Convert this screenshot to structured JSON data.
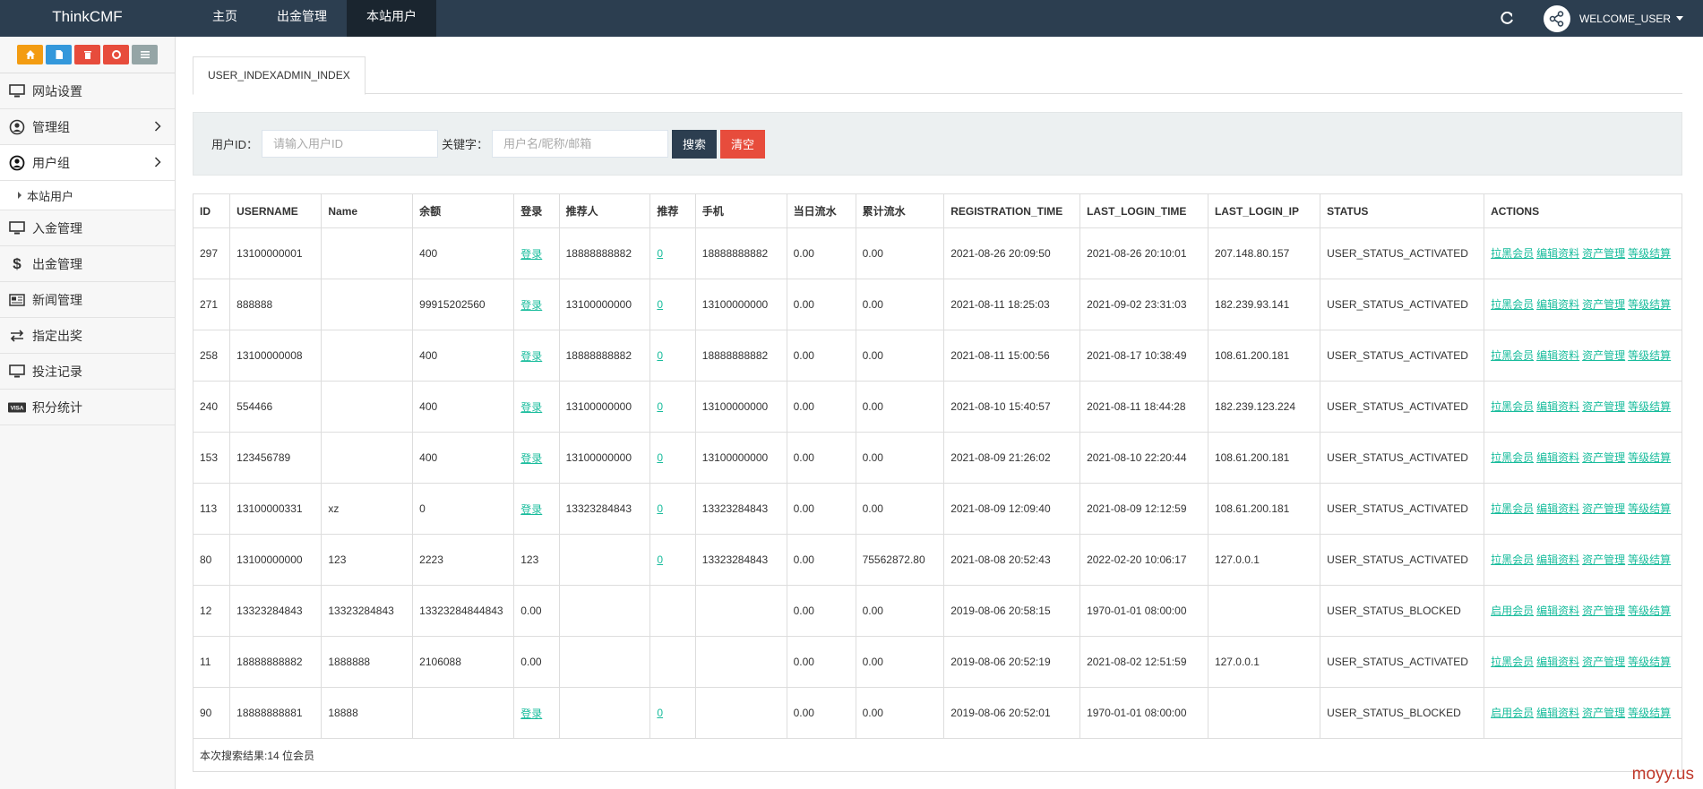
{
  "brand": "ThinkCMF",
  "nav": {
    "tabs": [
      "主页",
      "出金管理",
      "本站用户"
    ],
    "active": 2
  },
  "header": {
    "welcome": "WELCOME_USER"
  },
  "sidebar": {
    "items": [
      {
        "label": "网站设置",
        "icon": "monitor-icon"
      },
      {
        "label": "管理组",
        "icon": "user-circle-icon",
        "chevron": true
      },
      {
        "label": "用户组",
        "icon": "user-circle-icon",
        "chevron": true,
        "active": true
      },
      {
        "label": "入金管理",
        "icon": "monitor-icon"
      },
      {
        "label": "出金管理",
        "icon": "dollar-icon"
      },
      {
        "label": "新闻管理",
        "icon": "newspaper-icon"
      },
      {
        "label": "指定出奖",
        "icon": "exchange-icon"
      },
      {
        "label": "投注记录",
        "icon": "monitor-icon"
      },
      {
        "label": "积分统计",
        "icon": "visa-icon"
      }
    ],
    "sub_item": "本站用户"
  },
  "page_tab": "USER_INDEXADMIN_INDEX",
  "search": {
    "uid_label": "用户ID：",
    "uid_placeholder": "请输入用户ID",
    "keyword_label": "关键字：",
    "keyword_placeholder": "用户名/昵称/邮箱",
    "search_button": "搜索",
    "clear_button": "清空"
  },
  "table": {
    "headers": [
      "ID",
      "USERNAME",
      "Name",
      "余额",
      "登录",
      "推荐人",
      "推荐",
      "手机",
      "当日流水",
      "累计流水",
      "REGISTRATION_TIME",
      "LAST_LOGIN_TIME",
      "LAST_LOGIN_IP",
      "STATUS",
      "ACTIONS"
    ],
    "rows": [
      {
        "id": "297",
        "username": "13100000001",
        "name": "",
        "balance": "400",
        "login": "登录",
        "referrer": "18888888882",
        "refcount": "0",
        "phone": "18888888882",
        "daily": "0.00",
        "total": "0.00",
        "reg": "2021-08-26 20:09:50",
        "last": "2021-08-26 20:10:01",
        "ip": "207.148.80.157",
        "status": "USER_STATUS_ACTIVATED",
        "actions": [
          "拉黑会员",
          "编辑资料",
          "资产管理",
          "等级结算"
        ]
      },
      {
        "id": "271",
        "username": "888888",
        "name": "",
        "balance": "99915202560",
        "login": "登录",
        "referrer": "13100000000",
        "refcount": "0",
        "phone": "13100000000",
        "daily": "0.00",
        "total": "0.00",
        "reg": "2021-08-11 18:25:03",
        "last": "2021-09-02 23:31:03",
        "ip": "182.239.93.141",
        "status": "USER_STATUS_ACTIVATED",
        "actions": [
          "拉黑会员",
          "编辑资料",
          "资产管理",
          "等级结算"
        ]
      },
      {
        "id": "258",
        "username": "13100000008",
        "name": "",
        "balance": "400",
        "login": "登录",
        "referrer": "18888888882",
        "refcount": "0",
        "phone": "18888888882",
        "daily": "0.00",
        "total": "0.00",
        "reg": "2021-08-11 15:00:56",
        "last": "2021-08-17 10:38:49",
        "ip": "108.61.200.181",
        "status": "USER_STATUS_ACTIVATED",
        "actions": [
          "拉黑会员",
          "编辑资料",
          "资产管理",
          "等级结算"
        ]
      },
      {
        "id": "240",
        "username": "554466",
        "name": "",
        "balance": "400",
        "login": "登录",
        "referrer": "13100000000",
        "refcount": "0",
        "phone": "13100000000",
        "daily": "0.00",
        "total": "0.00",
        "reg": "2021-08-10 15:40:57",
        "last": "2021-08-11 18:44:28",
        "ip": "182.239.123.224",
        "status": "USER_STATUS_ACTIVATED",
        "actions": [
          "拉黑会员",
          "编辑资料",
          "资产管理",
          "等级结算"
        ]
      },
      {
        "id": "153",
        "username": "123456789",
        "name": "",
        "balance": "400",
        "login": "登录",
        "referrer": "13100000000",
        "refcount": "0",
        "phone": "13100000000",
        "daily": "0.00",
        "total": "0.00",
        "reg": "2021-08-09 21:26:02",
        "last": "2021-08-10 22:20:44",
        "ip": "108.61.200.181",
        "status": "USER_STATUS_ACTIVATED",
        "actions": [
          "拉黑会员",
          "编辑资料",
          "资产管理",
          "等级结算"
        ]
      },
      {
        "id": "113",
        "username": "13100000331",
        "name": "xz",
        "balance": "0",
        "login": "登录",
        "referrer": "13323284843",
        "refcount": "0",
        "phone": "13323284843",
        "daily": "0.00",
        "total": "0.00",
        "reg": "2021-08-09 12:09:40",
        "last": "2021-08-09 12:12:59",
        "ip": "108.61.200.181",
        "status": "USER_STATUS_ACTIVATED",
        "actions": [
          "拉黑会员",
          "编辑资料",
          "资产管理",
          "等级结算"
        ]
      },
      {
        "id": "80",
        "username": "13100000000",
        "name": "123",
        "balance": "2223",
        "login": "123",
        "referrer": "",
        "refcount": "0",
        "phone": "13323284843",
        "daily": "0.00",
        "total": "75562872.80",
        "reg": "2021-08-08 20:52:43",
        "last": "2022-02-20 10:06:17",
        "ip": "127.0.0.1",
        "status": "USER_STATUS_ACTIVATED",
        "actions": [
          "拉黑会员",
          "编辑资料",
          "资产管理",
          "等级结算"
        ]
      },
      {
        "id": "12",
        "username": "13323284843",
        "name": "13323284843",
        "balance": "13323284844843",
        "login": "0.00",
        "referrer": "",
        "refcount": "",
        "phone": "",
        "daily": "0.00",
        "total": "0.00",
        "reg": "2019-08-06 20:58:15",
        "last": "1970-01-01 08:00:00",
        "ip": "",
        "status": "USER_STATUS_BLOCKED",
        "actions": [
          "启用会员",
          "编辑资料",
          "资产管理",
          "等级结算"
        ]
      },
      {
        "id": "11",
        "username": "18888888882",
        "name": "1888888",
        "balance": "2106088",
        "login": "0.00",
        "referrer": "",
        "refcount": "",
        "phone": "",
        "daily": "0.00",
        "total": "0.00",
        "reg": "2019-08-06 20:52:19",
        "last": "2021-08-02 12:51:59",
        "ip": "127.0.0.1",
        "status": "USER_STATUS_ACTIVATED",
        "actions": [
          "拉黑会员",
          "编辑资料",
          "资产管理",
          "等级结算"
        ]
      },
      {
        "id": "90",
        "username": "18888888881",
        "name": "18888",
        "balance": "",
        "login": "登录",
        "referrer": "",
        "refcount": "0",
        "phone": "",
        "daily": "0.00",
        "total": "0.00",
        "reg": "2019-08-06 20:52:01",
        "last": "1970-01-01 08:00:00",
        "ip": "",
        "status": "USER_STATUS_BLOCKED",
        "actions": [
          "启用会员",
          "编辑资料",
          "资产管理",
          "等级结算"
        ]
      }
    ],
    "footer": "本次搜索结果:14 位会员"
  },
  "watermark": "moyy.us",
  "colors": {
    "topbar": "#2c3e50",
    "active_tab": "#1a252f",
    "link": "#18bc9c",
    "danger": "#e74c3c",
    "shortcut": [
      "#f39c12",
      "#3498db",
      "#e74c3c",
      "#e74c3c",
      "#95a5a6"
    ]
  }
}
